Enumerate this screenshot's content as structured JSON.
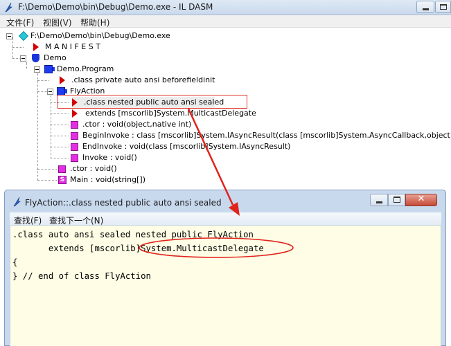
{
  "main_window": {
    "title": "F:\\Demo\\Demo\\bin\\Debug\\Demo.exe - IL DASM",
    "menu": [
      "文件(F)",
      "视图(V)",
      "帮助(H)"
    ]
  },
  "tree": {
    "root": "F:\\Demo\\Demo\\bin\\Debug\\Demo.exe",
    "manifest": "M A N I F E S T",
    "namespace": "Demo",
    "class_program": "Demo.Program",
    "program_class_decl": ".class private auto ansi beforefieldinit",
    "class_flyaction": "FlyAction",
    "fly_class_decl": ".class nested public auto ansi sealed",
    "fly_extends": "extends [mscorlib]System.MulticastDelegate",
    "fly_ctor": ".ctor : void(object,native int)",
    "fly_begin_invoke": "BeginInvoke : class [mscorlib]System.IAsyncResult(class [mscorlib]System.AsyncCallback,object)",
    "fly_end_invoke": "EndInvoke : void(class [mscorlib]System.IAsyncResult)",
    "fly_invoke": "Invoke : void()",
    "program_ctor": ".ctor : void()",
    "program_main": "Main : void(string[])"
  },
  "child_window": {
    "title": "FlyAction::.class nested public auto ansi sealed",
    "menu": [
      "查找(F)",
      "查找下一个(N)"
    ],
    "close_glyph": "✕",
    "code_lines": [
      ".class auto ansi sealed nested public FlyAction",
      "       extends [mscorlib]System.MulticastDelegate",
      "{",
      "} // end of class FlyAction"
    ]
  },
  "colors": {
    "annotation_red": "#e0231b",
    "code_background": "#fffde5",
    "class_icon": "#1f3cf0",
    "method_icon": "#e32ee3",
    "type_marker": "#d40000"
  }
}
